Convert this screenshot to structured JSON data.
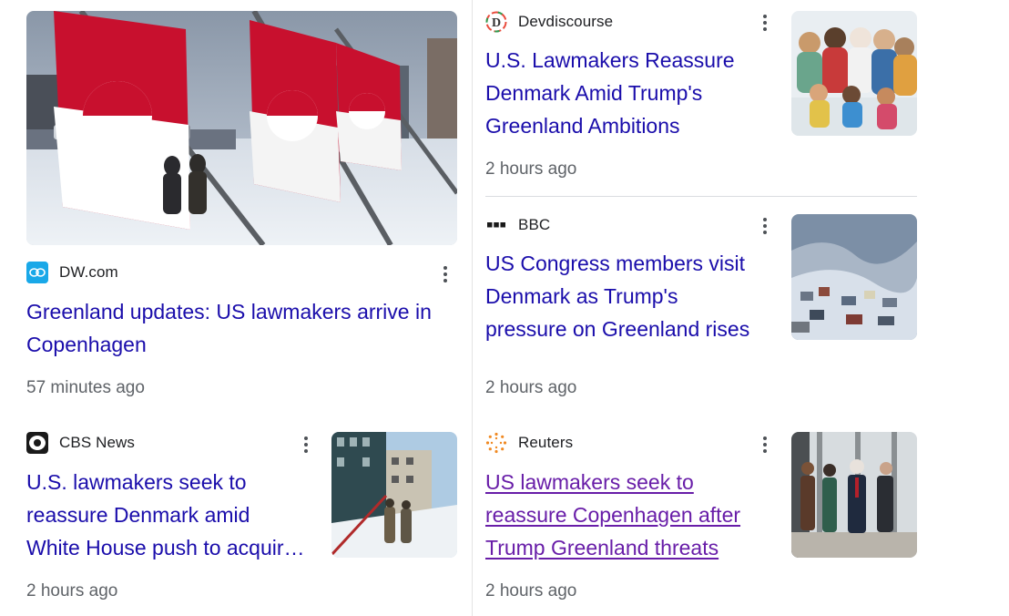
{
  "articles": [
    {
      "source": "DW.com",
      "logo_icon": "dw-logo-icon",
      "title": "Greenland updates: US lawmakers arrive in Copenhagen",
      "time": "57 minutes ago",
      "visited": false
    },
    {
      "source": "Devdiscourse",
      "logo_icon": "devdiscourse-logo-icon",
      "title_lines": [
        "U.S. Lawmakers Reassure",
        "Denmark Amid Trump's",
        "Greenland Ambitions"
      ],
      "time": "2 hours ago",
      "visited": false
    },
    {
      "source": "BBC",
      "logo_icon": "bbc-logo-icon",
      "title_lines": [
        "US Congress members visit",
        "Denmark as Trump's",
        "pressure on Greenland rises"
      ],
      "time": "2 hours ago",
      "visited": false
    },
    {
      "source": "CBS News",
      "logo_icon": "cbs-logo-icon",
      "title_lines": [
        "U.S. lawmakers seek to",
        "reassure Denmark amid",
        "White House push to acquir…"
      ],
      "time": "2 hours ago",
      "visited": false
    },
    {
      "source": "Reuters",
      "logo_icon": "reuters-logo-icon",
      "title_lines": [
        "US lawmakers seek to",
        "reassure Copenhagen after",
        "Trump Greenland threats"
      ],
      "time": "2 hours ago",
      "visited": true
    }
  ],
  "colors": {
    "link": "#1a0dab",
    "visited_link": "#681da8",
    "meta": "#5f6368"
  }
}
